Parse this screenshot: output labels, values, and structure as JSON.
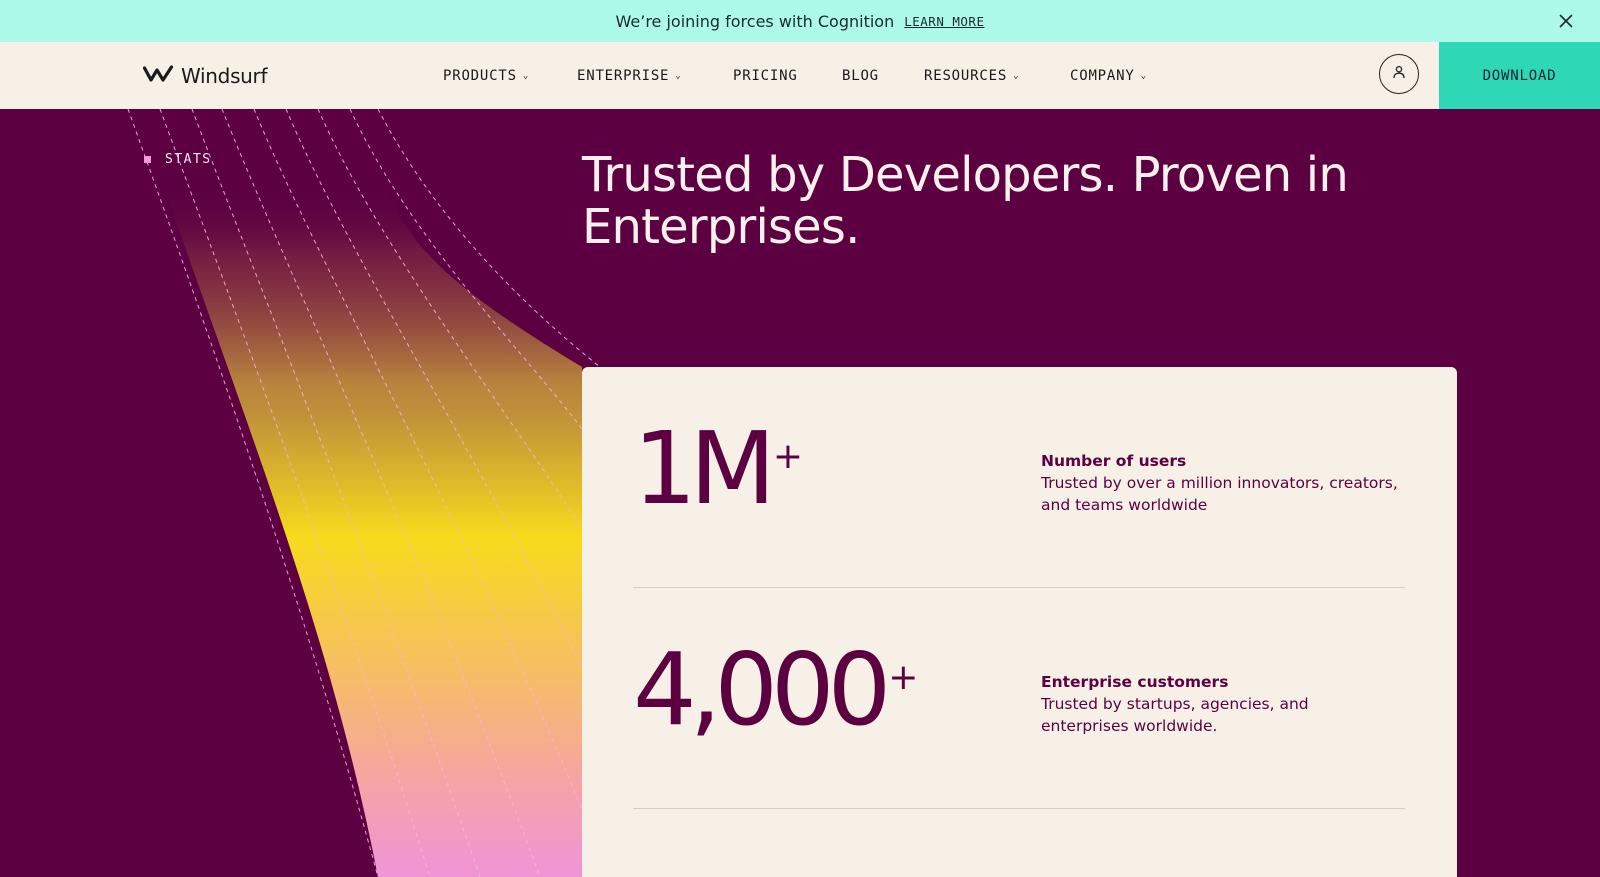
{
  "announcement": {
    "message": "We’re joining forces with Cognition",
    "link_label": "LEARN MORE"
  },
  "nav": {
    "brand": "Windsurf",
    "items": [
      {
        "label": "PRODUCTS",
        "has_dropdown": true
      },
      {
        "label": "ENTERPRISE",
        "has_dropdown": true
      },
      {
        "label": "PRICING",
        "has_dropdown": false
      },
      {
        "label": "BLOG",
        "has_dropdown": false
      },
      {
        "label": "RESOURCES",
        "has_dropdown": true
      },
      {
        "label": "COMPANY",
        "has_dropdown": true
      }
    ],
    "dropdown_glyph": "⌄",
    "account_icon": "user-icon",
    "download_label": "DOWNLOAD"
  },
  "hero": {
    "section_tag": "STATS",
    "headline": "Trusted by Developers. Proven in Enterprises."
  },
  "stats": [
    {
      "value": "1M",
      "suffix": "+",
      "title": "Number of users",
      "description": "Trusted by over a million innovators, creators, and teams worldwide"
    },
    {
      "value": "4,000",
      "suffix": "+",
      "title": "Enterprise customers",
      "description": "Trusted by startups, agencies, and enterprises worldwide."
    }
  ],
  "colors": {
    "announcement_bg": "#aefae8",
    "nav_bg": "#f6f0e6",
    "download_bg": "#2ed8b7",
    "hero_bg": "#5c0042",
    "card_bg": "#f6f0e6",
    "accent_text": "#5c0042"
  }
}
